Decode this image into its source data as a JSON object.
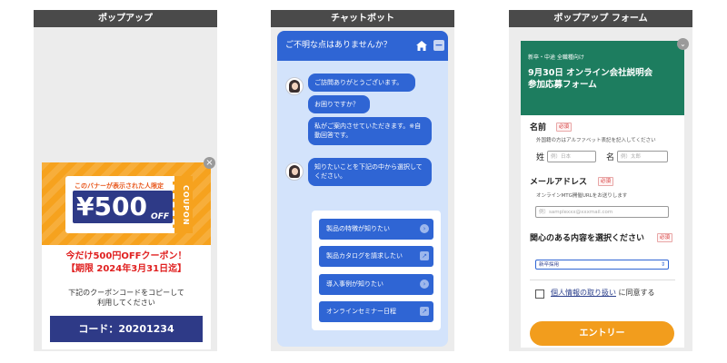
{
  "panels": {
    "popup_title": "ポップアップ",
    "chatbot_title": "チャットボット",
    "form_title": "ポップアップ フォーム"
  },
  "popup": {
    "close": "×",
    "banner_limited": "このバナーが表示された人限定",
    "price": "¥500",
    "off": "OFF",
    "coupon_tag": "COUPON",
    "headline1": "今だけ500円OFFクーポン！",
    "headline2": "【期限 2024年3月31日迄】",
    "instruction1": "下記のクーポンコードをコピーして",
    "instruction2": "利用してください",
    "code_label": "コード：20201234"
  },
  "chatbot": {
    "header": "ご不明な点はありませんか？",
    "messages": [
      "ご訪問ありがとうございます。",
      "お困りですか？",
      "私がご案内させていただきます。※自動回答です。",
      "知りたいことを下記の中から選択してください。"
    ],
    "options": [
      "製品の特徴が知りたい",
      "製品カタログを請求したい",
      "導入事例が知りたい",
      "オンラインセミナー日程"
    ]
  },
  "form": {
    "close": "⌄",
    "subtitle": "新卒・中途 全職種向け",
    "title1": "9月30日 オンライン会社説明会",
    "title2": "参加応募フォーム",
    "required": "必須",
    "name_label": "名前",
    "name_note": "外国籍の方はアルファベット表記を記入してください",
    "sei_label": "姓",
    "sei_placeholder": "例）日本",
    "mei_label": "名",
    "mei_placeholder": "例）太郎",
    "email_label": "メールアドレス",
    "email_note": "オンラインMTG開催URLをお送りします",
    "email_placeholder": "例）samplexxx@xxxmail.com",
    "interest_label": "関心のある内容を選択ください",
    "interest_value": "新卒採用",
    "consent_link": "個人情報の取り扱い",
    "consent_text": "に同意する",
    "submit": "エントリー"
  },
  "colors": {
    "header_bar": "#4a4a4a",
    "popup_orange": "#f6a21e",
    "navy": "#2e3a87",
    "chat_blue": "#2f65d4",
    "form_green": "#1d7d5f",
    "entry_orange": "#f29d1d"
  }
}
